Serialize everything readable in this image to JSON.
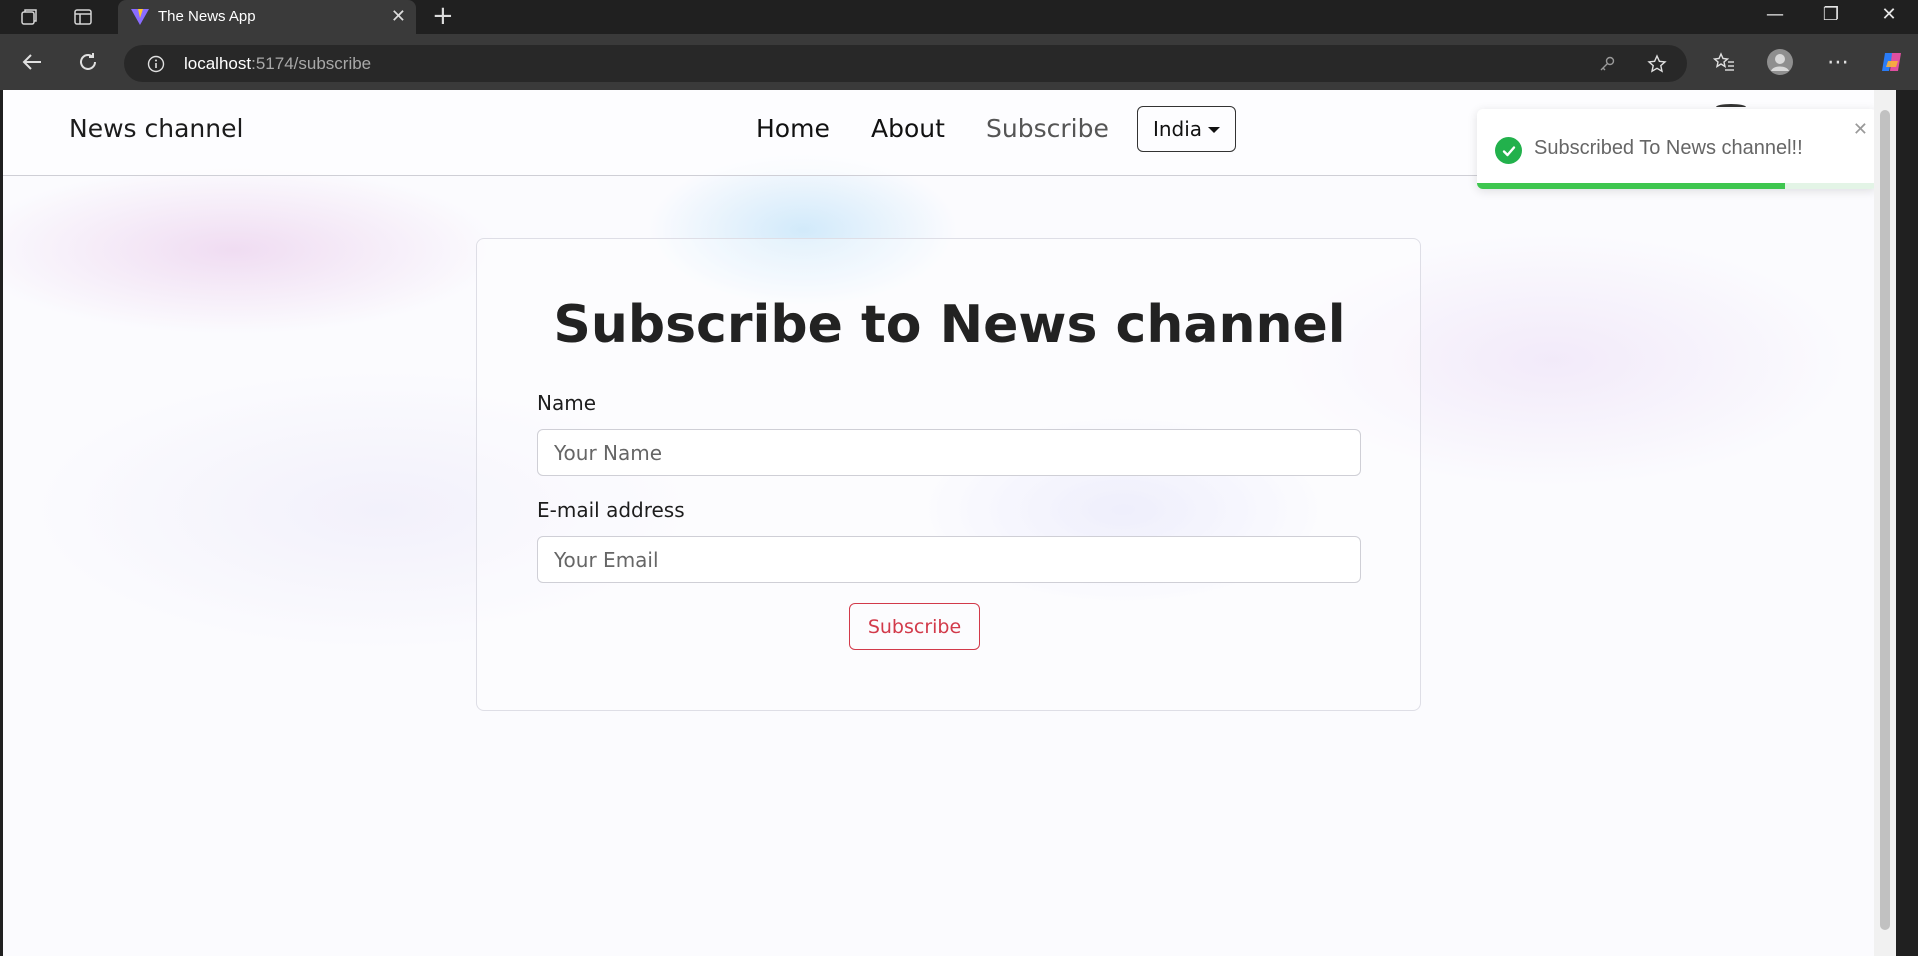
{
  "browser": {
    "tab_title": "The News App",
    "url_host": "localhost",
    "url_rest": ":5174/subscribe"
  },
  "nav": {
    "brand": "News channel",
    "links": [
      "Home",
      "About",
      "Subscribe"
    ],
    "country_label": "India"
  },
  "form": {
    "title": "Subscribe to News channel",
    "name_label": "Name",
    "name_placeholder": "Your Name",
    "email_label": "E-mail address",
    "email_placeholder": "Your Email",
    "submit_label": "Subscribe"
  },
  "toast": {
    "message": "Subscribed To News channel!!",
    "progress_fraction": 0.77,
    "accent_color": "#22b14c"
  }
}
